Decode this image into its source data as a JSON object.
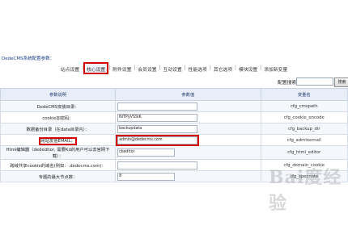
{
  "header": {
    "title": "DedeCMS系统配置参数："
  },
  "tabs": [
    {
      "label": "站点设置",
      "active": false
    },
    {
      "label": "核心设置",
      "active": true
    },
    {
      "label": "附件设置",
      "active": false
    },
    {
      "label": "会员设置",
      "active": false
    },
    {
      "label": "互动设置",
      "active": false
    },
    {
      "label": "性能选项",
      "active": false
    },
    {
      "label": "其它选项",
      "active": false
    },
    {
      "label": "模块设置",
      "active": false
    },
    {
      "label": "添加新变量",
      "active": false
    }
  ],
  "tab_separator": "|",
  "search": {
    "label": "配置搜索：",
    "value": "",
    "button_label": "搜索"
  },
  "table": {
    "headers": [
      "参数说明",
      "参数值",
      "变量名"
    ],
    "rows": [
      {
        "label": "DedeCMS安装目录：",
        "value": "",
        "var": "cfg_cmspath"
      },
      {
        "label": "cookie加密码：",
        "value": "NiTPyVSSIK",
        "var": "cfg_cookie_encode"
      },
      {
        "label": "数据备份目录（在data目录内）：",
        "value": "backupdata",
        "var": "cfg_backup_dir"
      },
      {
        "label": "网站发信EMAIL：",
        "value": "admin@dedecms.com",
        "var": "cfg_adminemail"
      },
      {
        "label": "Html编辑器（dededitor, 需要Kd的用户可以去官网下载）：",
        "value": "ckeditor",
        "var": "cfg_html_editor"
      },
      {
        "label": "跨域共享cookie的域名(例如：.dedecms.com)：",
        "value": "",
        "var": "cfg_domain_cookie"
      },
      {
        "label": "专题的最大节点数：",
        "value": "8",
        "var": "cfg_specnote"
      }
    ]
  },
  "watermark": "Bai度经验",
  "colors": {
    "highlight": "#d40000",
    "header_bg": "#e7eef8",
    "title": "#1a3c8a"
  }
}
